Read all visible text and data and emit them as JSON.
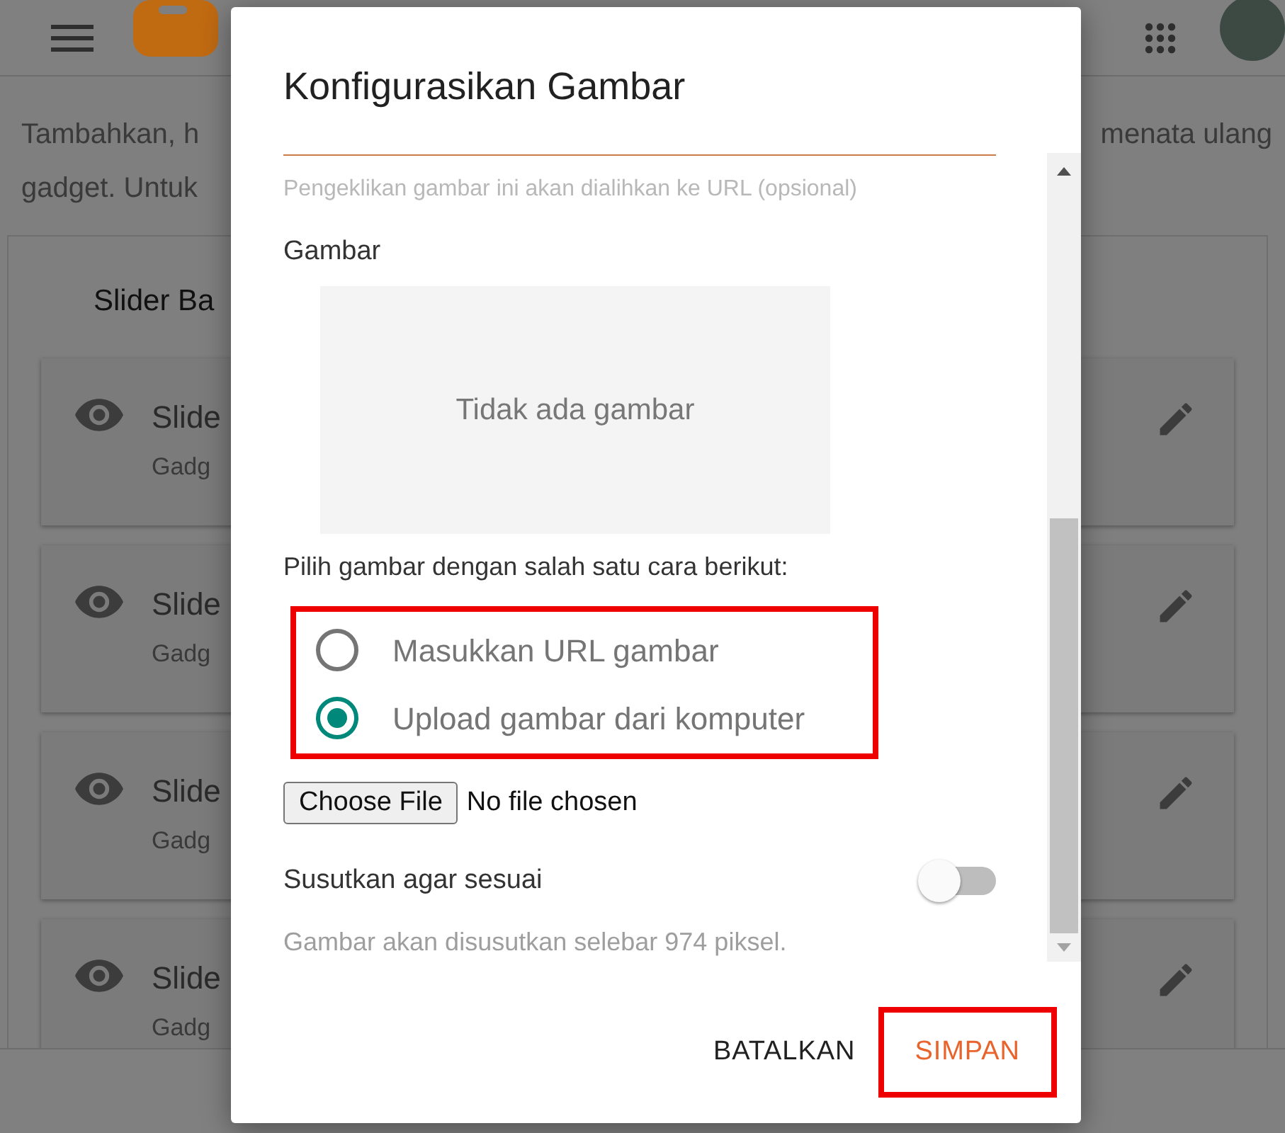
{
  "intro": {
    "line_1_left": "Tambahkan, h",
    "line_1_right": "menata ulang",
    "line_2_left": "gadget. Untuk"
  },
  "panel": {
    "title": "Slider Ba",
    "gadgets": [
      {
        "title": "Slide",
        "subtitle": "Gadg"
      },
      {
        "title": "Slide",
        "subtitle": "Gadg"
      },
      {
        "title": "Slide",
        "subtitle": "Gadg"
      },
      {
        "title": "Slide",
        "subtitle": "Gadg"
      }
    ]
  },
  "dialog": {
    "title": "Konfigurasikan Gambar",
    "link_helper": "Pengeklikan gambar ini akan dialihkan ke URL (opsional)",
    "image_label": "Gambar",
    "image_placeholder": "Tidak ada gambar",
    "choose_prompt": "Pilih gambar dengan salah satu cara berikut:",
    "options": [
      {
        "label": "Masukkan URL gambar",
        "selected": false
      },
      {
        "label": "Upload gambar dari komputer",
        "selected": true
      }
    ],
    "file": {
      "button": "Choose File",
      "status": "No file chosen"
    },
    "shrink": {
      "label": "Susutkan agar sesuai",
      "on": false,
      "helper": "Gambar akan disusutkan selebar 974 piksel."
    },
    "buttons": [
      {
        "label": "BATALKAN",
        "kind": "cancel",
        "highlighted": false
      },
      {
        "label": "SIMPAN",
        "kind": "save",
        "highlighted": true
      }
    ]
  }
}
